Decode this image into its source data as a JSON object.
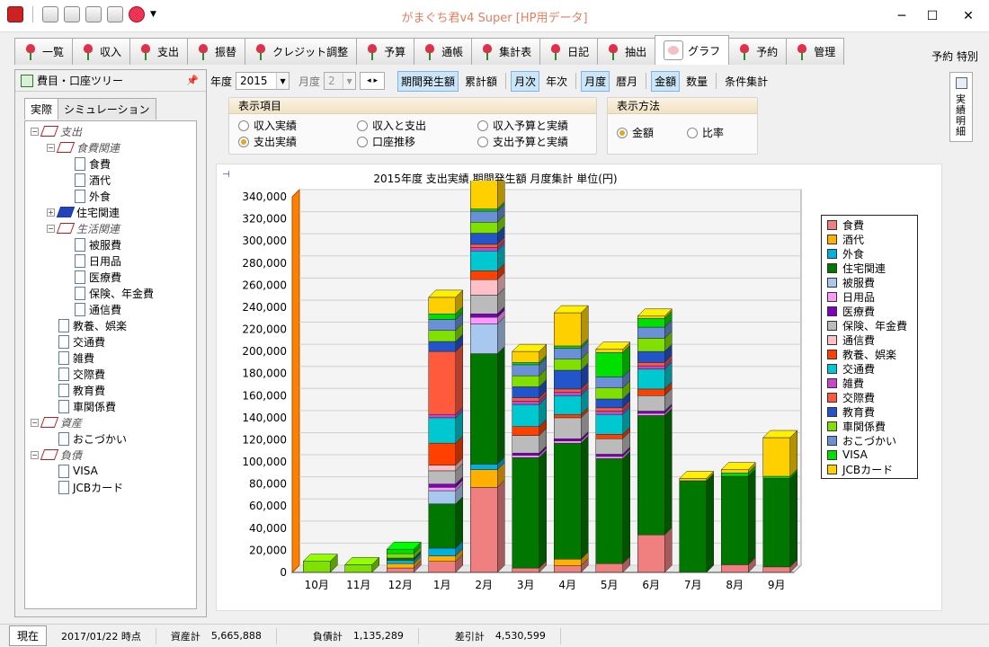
{
  "window": {
    "title": "がまぐち君v4 Super  [HP用データ]"
  },
  "tabs": [
    {
      "label": "一覧"
    },
    {
      "label": "収入"
    },
    {
      "label": "支出"
    },
    {
      "label": "振替"
    },
    {
      "label": "クレジット調整"
    },
    {
      "label": "予算"
    },
    {
      "label": "通帳"
    },
    {
      "label": "集計表"
    },
    {
      "label": "日記"
    },
    {
      "label": "抽出"
    },
    {
      "label": "グラフ",
      "active": true
    },
    {
      "label": "予約"
    },
    {
      "label": "管理"
    }
  ],
  "topright": {
    "label": "予約 特別"
  },
  "tree_panel": {
    "title": "費目・口座ツリー",
    "pin": "📌",
    "tabs": [
      "実際",
      "シミュレーション"
    ],
    "items": [
      {
        "label": "支出",
        "kind": "cat"
      },
      {
        "label": "食費関連",
        "kind": "cat"
      },
      {
        "label": "食費",
        "kind": "doc"
      },
      {
        "label": "酒代",
        "kind": "doc"
      },
      {
        "label": "外食",
        "kind": "doc"
      },
      {
        "label": "住宅関連",
        "kind": "blue"
      },
      {
        "label": "生活関連",
        "kind": "cat"
      },
      {
        "label": "被服費",
        "kind": "doc"
      },
      {
        "label": "日用品",
        "kind": "doc"
      },
      {
        "label": "医療費",
        "kind": "doc"
      },
      {
        "label": "保険、年金費",
        "kind": "doc"
      },
      {
        "label": "通信費",
        "kind": "doc"
      },
      {
        "label": "教養、娯楽",
        "kind": "doc"
      },
      {
        "label": "交通費",
        "kind": "doc"
      },
      {
        "label": "雑費",
        "kind": "doc"
      },
      {
        "label": "交際費",
        "kind": "doc"
      },
      {
        "label": "教育費",
        "kind": "doc"
      },
      {
        "label": "車関係費",
        "kind": "doc"
      },
      {
        "label": "資産",
        "kind": "cat"
      },
      {
        "label": "おこづかい",
        "kind": "doc"
      },
      {
        "label": "負債",
        "kind": "cat"
      },
      {
        "label": "VISA",
        "kind": "doc"
      },
      {
        "label": "JCBカード",
        "kind": "doc"
      }
    ]
  },
  "toolbar": {
    "year_label": "年度",
    "year_value": "2015",
    "month_label": "月度",
    "month_value": "2",
    "buttons": [
      {
        "label": "期間発生額",
        "on": true
      },
      {
        "label": "累計額",
        "on": false
      },
      {
        "label": "月次",
        "on": true
      },
      {
        "label": "年次",
        "on": false
      },
      {
        "label": "月度",
        "on": true
      },
      {
        "label": "暦月",
        "on": false
      },
      {
        "label": "金額",
        "on": true
      },
      {
        "label": "数量",
        "on": false
      },
      {
        "label": "条件集計",
        "on": false
      }
    ]
  },
  "display_items": {
    "title": "表示項目",
    "options": [
      {
        "label": "収入実績",
        "selected": false
      },
      {
        "label": "収入と支出",
        "selected": false
      },
      {
        "label": "収入予算と実績",
        "selected": false
      },
      {
        "label": "支出実績",
        "selected": true
      },
      {
        "label": "口座推移",
        "selected": false
      },
      {
        "label": "支出予算と実績",
        "selected": false
      }
    ]
  },
  "display_method": {
    "title": "表示方法",
    "options": [
      {
        "label": "金額",
        "selected": true
      },
      {
        "label": "比率",
        "selected": false
      }
    ]
  },
  "right_rail": {
    "label": "実績明細"
  },
  "status": {
    "now_button": "現在",
    "date": "2017/01/22 時点",
    "assets_label": "資産計",
    "assets_value": "5,665,888",
    "liab_label": "負債計",
    "liab_value": "1,135,289",
    "diff_label": "差引計",
    "diff_value": "4,530,599"
  },
  "chart_data": {
    "type": "bar",
    "stacked": true,
    "title": "2015年度 支出実績  期間発生額  月度集計   単位(円)",
    "categories": [
      "10月",
      "11月",
      "12月",
      "1月",
      "2月",
      "3月",
      "4月",
      "5月",
      "6月",
      "7月",
      "8月",
      "9月"
    ],
    "ylim": [
      0,
      340000
    ],
    "yticks": [
      "0",
      "20,000",
      "40,000",
      "60,000",
      "80,000",
      "100,000",
      "120,000",
      "140,000",
      "160,000",
      "180,000",
      "200,000",
      "220,000",
      "240,000",
      "260,000",
      "280,000",
      "300,000",
      "320,000",
      "340,000"
    ],
    "grid": true,
    "legend_position": "right",
    "series": [
      {
        "name": "食費",
        "color": "#f08080",
        "values": [
          0,
          0,
          4000,
          10000,
          77000,
          4000,
          6000,
          8000,
          34000,
          0,
          7000,
          5000
        ]
      },
      {
        "name": "酒代",
        "color": "#ffb000",
        "values": [
          0,
          0,
          4000,
          5000,
          16000,
          0,
          6000,
          0,
          0,
          0,
          0,
          0
        ]
      },
      {
        "name": "外食",
        "color": "#00b0e0",
        "values": [
          0,
          0,
          3000,
          7000,
          5000,
          0,
          0,
          0,
          0,
          0,
          0,
          0
        ]
      },
      {
        "name": "住宅関連",
        "color": "#007800",
        "values": [
          0,
          0,
          2000,
          40000,
          100000,
          100000,
          105000,
          95000,
          108000,
          83000,
          80000,
          80000
        ]
      },
      {
        "name": "被服費",
        "color": "#a8c8f0",
        "values": [
          0,
          0,
          0,
          12000,
          27000,
          0,
          0,
          0,
          0,
          0,
          0,
          0
        ]
      },
      {
        "name": "日用品",
        "color": "#ff99ff",
        "values": [
          0,
          0,
          0,
          3000,
          6000,
          2000,
          2000,
          2000,
          2000,
          0,
          0,
          0
        ]
      },
      {
        "name": "医療費",
        "color": "#8000c0",
        "values": [
          0,
          0,
          0,
          3000,
          3000,
          2000,
          2000,
          2000,
          2000,
          0,
          0,
          0
        ]
      },
      {
        "name": "保険、年金費",
        "color": "#bbbbbb",
        "values": [
          0,
          0,
          0,
          12000,
          17000,
          16000,
          19000,
          14000,
          14000,
          0,
          0,
          0
        ]
      },
      {
        "name": "通信費",
        "color": "#ffc0c8",
        "values": [
          0,
          0,
          0,
          5000,
          14000,
          0,
          0,
          0,
          0,
          0,
          0,
          0
        ]
      },
      {
        "name": "教養、娯楽",
        "color": "#ff4000",
        "values": [
          0,
          0,
          0,
          20000,
          8000,
          8000,
          3000,
          4000,
          6000,
          0,
          0,
          0
        ]
      },
      {
        "name": "交通費",
        "color": "#00c8d0",
        "values": [
          0,
          0,
          0,
          23000,
          18000,
          20000,
          17000,
          18000,
          18000,
          0,
          0,
          0
        ]
      },
      {
        "name": "雑費",
        "color": "#cc44cc",
        "values": [
          0,
          0,
          0,
          3000,
          3000,
          3000,
          3000,
          3000,
          3000,
          0,
          0,
          0
        ]
      },
      {
        "name": "交際費",
        "color": "#ff5a3c",
        "values": [
          0,
          0,
          0,
          57000,
          3000,
          3000,
          3000,
          3000,
          3000,
          0,
          0,
          0
        ]
      },
      {
        "name": "教育費",
        "color": "#2255cc",
        "values": [
          0,
          0,
          0,
          9000,
          10000,
          10000,
          17000,
          8000,
          10000,
          0,
          0,
          0
        ]
      },
      {
        "name": "車関係費",
        "color": "#80e000",
        "values": [
          10000,
          7000,
          4000,
          10000,
          10000,
          10000,
          10000,
          10000,
          12000,
          0,
          0,
          0
        ]
      },
      {
        "name": "おこづかい",
        "color": "#6a90d8",
        "values": [
          0,
          0,
          0,
          10000,
          10000,
          10000,
          10000,
          10000,
          10000,
          0,
          0,
          0
        ]
      },
      {
        "name": "VISA",
        "color": "#00e000",
        "values": [
          0,
          0,
          4000,
          5000,
          2000,
          2000,
          2000,
          22000,
          8000,
          0,
          3000,
          2000
        ]
      },
      {
        "name": "JCBカード",
        "color": "#ffd000",
        "values": [
          0,
          0,
          0,
          15000,
          38000,
          10000,
          30000,
          3000,
          2000,
          2000,
          3000,
          35000
        ]
      }
    ]
  }
}
